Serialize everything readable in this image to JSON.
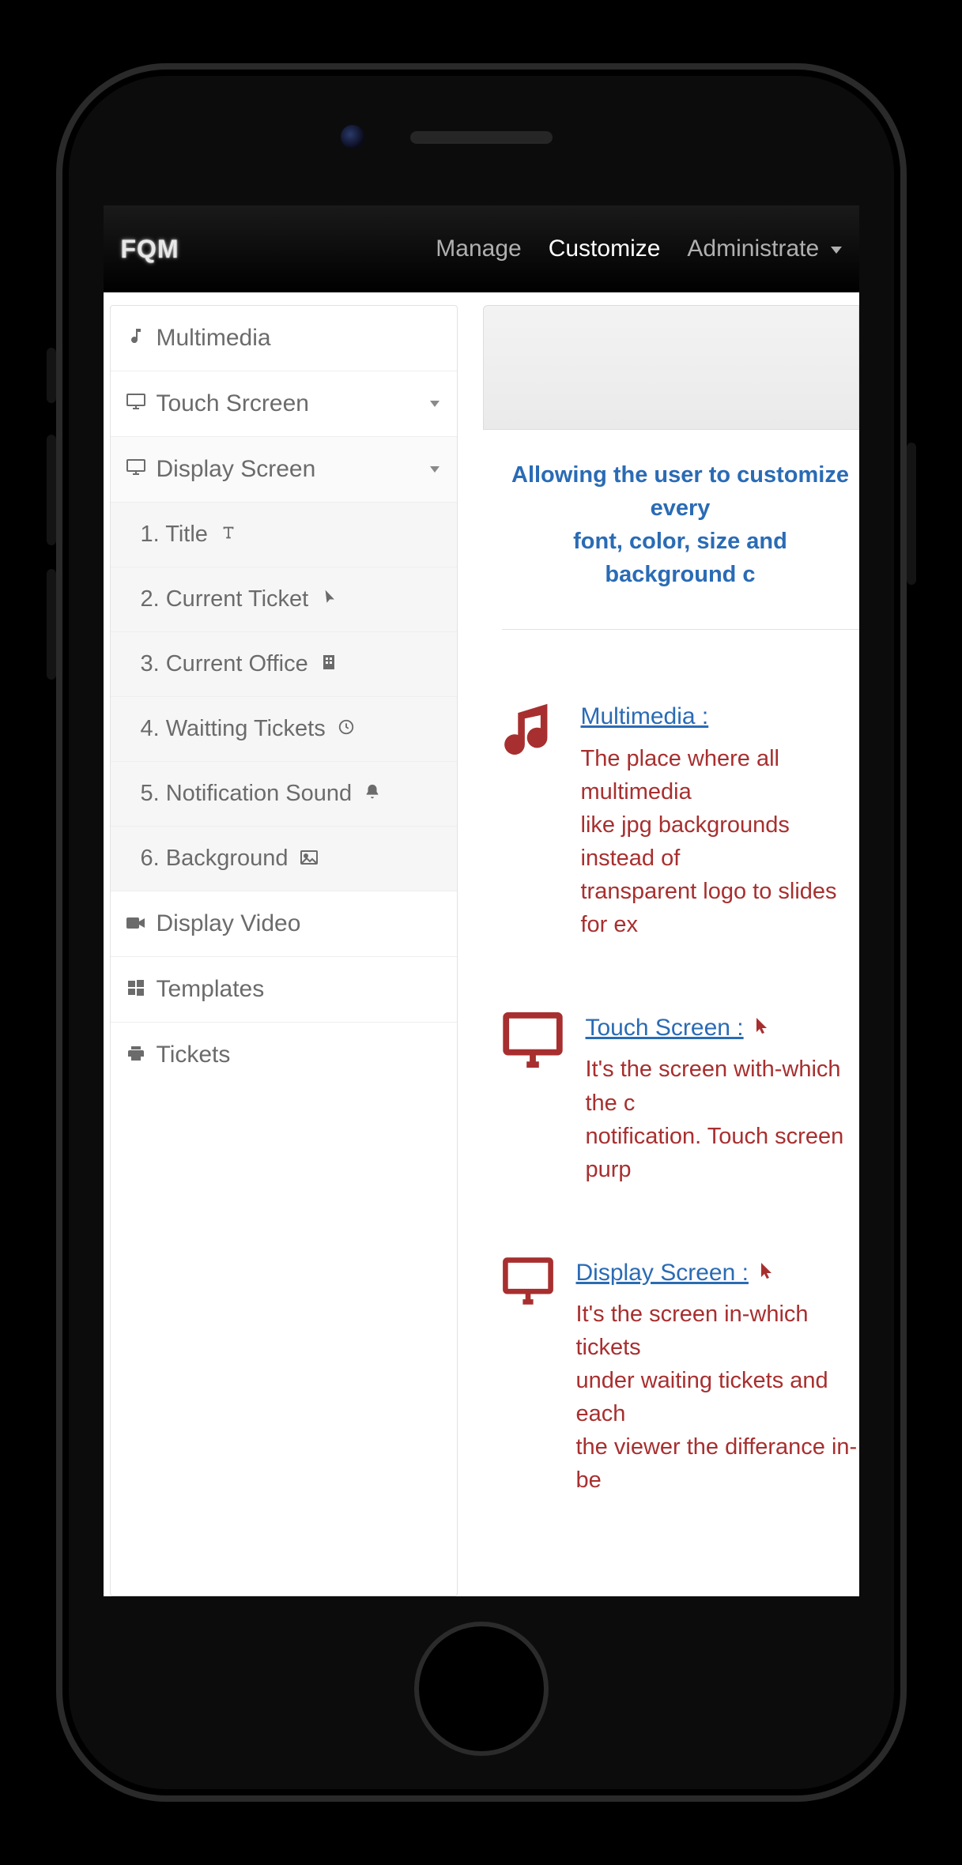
{
  "brand": "FQM",
  "topnav": {
    "manage": "Manage",
    "customize": "Customize",
    "administrate": "Administrate"
  },
  "sidebar": {
    "multimedia": "Multimedia",
    "touch_screen": "Touch Srcreen",
    "display_screen": "Display Screen",
    "display_sub": {
      "title": "1. Title",
      "current_ticket": "2. Current Ticket",
      "current_office": "3. Current Office",
      "waiting_tickets": "4. Waitting Tickets",
      "notification_sound": "5. Notification Sound",
      "background": "6. Background"
    },
    "display_video": "Display Video",
    "templates": "Templates",
    "tickets": "Tickets"
  },
  "intro": {
    "line1": "Allowing the user to customize every",
    "line2": "font, color, size and background c"
  },
  "sections": {
    "multimedia": {
      "heading": "Multimedia :",
      "p1": "The place where all multimedia",
      "p2": "like jpg backgrounds instead of",
      "p3": "transparent logo to slides for ex"
    },
    "touch": {
      "heading": "Touch Screen :",
      "p1": "It's the screen with-which the c",
      "p2": "notification. Touch screen purp"
    },
    "display": {
      "heading": "Display Screen :",
      "p1": "It's the screen in-which tickets",
      "p2": "under waiting tickets and each",
      "p3": "the viewer the differance in-be"
    }
  }
}
